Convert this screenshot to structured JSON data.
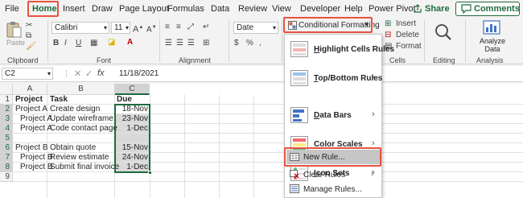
{
  "menu": {
    "tabs": [
      "File",
      "Home",
      "Insert",
      "Draw",
      "Page Layout",
      "Formulas",
      "Data",
      "Review",
      "View",
      "Developer",
      "Help",
      "Power Pivot"
    ],
    "share": "Share",
    "comments": "Comments"
  },
  "ribbon": {
    "paste": "Paste",
    "clipboard": "Clipboard",
    "font_name": "Calibri",
    "font_size": "11",
    "font_group": "Font",
    "bold": "B",
    "italic": "I",
    "underline": "U",
    "alignment": "Alignment",
    "number_format": "Date",
    "conditional_formatting": "Conditional Formatting",
    "insert": "Insert",
    "delete": "Delete",
    "format": "Format",
    "cells": "Cells",
    "editing": "Editing",
    "analyze_data_line1": "Analyze",
    "analyze_data_line2": "Data",
    "analysis": "Analysis"
  },
  "formula_bar": {
    "name_box": "C2",
    "fx": "fx",
    "value": "11/18/2021"
  },
  "grid": {
    "columns": [
      "A",
      "B",
      "C"
    ],
    "rows": [
      {
        "n": "1",
        "a": "Project",
        "b": "Task",
        "c": "Due"
      },
      {
        "n": "2",
        "a": "Project A",
        "b": "Create design",
        "c": "18-Nov"
      },
      {
        "n": "3",
        "a": "Project A",
        "b": "Update wireframe",
        "c": "23-Nov"
      },
      {
        "n": "4",
        "a": "Project A",
        "b": "Code contact page",
        "c": "1-Dec"
      },
      {
        "n": "5",
        "a": "",
        "b": "",
        "c": ""
      },
      {
        "n": "6",
        "a": "Project B",
        "b": "Obtain quote",
        "c": "15-Nov"
      },
      {
        "n": "7",
        "a": "Project B",
        "b": "Review estimate",
        "c": "24-Nov"
      },
      {
        "n": "8",
        "a": "Project B",
        "b": "Submit final invoice",
        "c": "1-Dec"
      },
      {
        "n": "9",
        "a": "",
        "b": "",
        "c": ""
      }
    ]
  },
  "dropdown": {
    "items": [
      {
        "label": "Highlight Cells Rules",
        "submenu": true
      },
      {
        "label": "Top/Bottom Rules",
        "submenu": true
      },
      {
        "label": "Data Bars",
        "submenu": true
      },
      {
        "label": "Color Scales",
        "submenu": true
      },
      {
        "label": "Icon Sets",
        "submenu": true
      }
    ],
    "new_rule": "New Rule...",
    "clear_rules": "Clear Rules",
    "manage_rules": "Manage Rules..."
  },
  "colors": {
    "accent": "#1e6b3c",
    "highlight": "#e8533f",
    "selected_cell": "#d9d9d9"
  }
}
